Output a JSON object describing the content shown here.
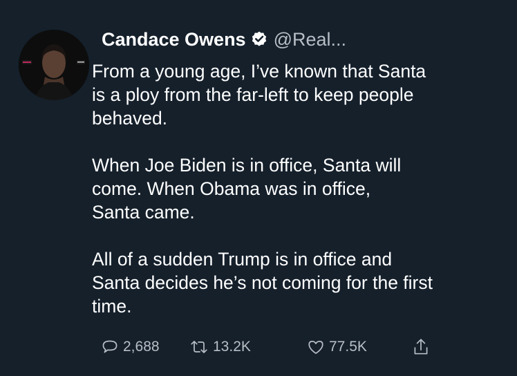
{
  "tweet": {
    "author": {
      "name": "Candace Owens",
      "handle": "@Real...",
      "verified": true,
      "avatar_icon": "profile-photo"
    },
    "paragraphs": [
      "From a young age, I’ve known that Santa\nis a ploy from the far-left to keep people\nbehaved.",
      "When Joe Biden is in office, Santa will\ncome. When Obama was in office,\nSanta came.",
      "All of a sudden Trump is in office and\nSanta decides he’s not coming for the first\ntime."
    ],
    "actions": {
      "reply": {
        "icon": "reply-icon",
        "count": "2,688"
      },
      "retweet": {
        "icon": "retweet-icon",
        "count": "13.2K"
      },
      "like": {
        "icon": "heart-icon",
        "count": "77.5K"
      },
      "share": {
        "icon": "share-icon"
      }
    }
  },
  "colors": {
    "background": "#15202b",
    "text": "#ffffff",
    "secondary_text": "#b8bec6",
    "verified_badge": "#ffffff"
  }
}
